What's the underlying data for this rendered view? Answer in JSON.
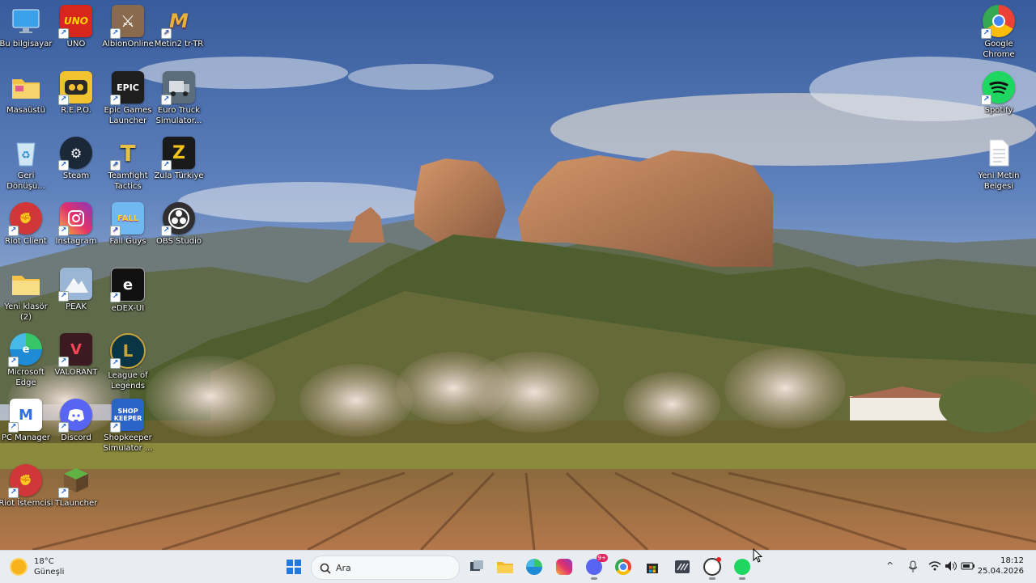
{
  "desktop": {
    "icons": [
      {
        "id": "bu-bilgisayar",
        "label": "Bu bilgisayar",
        "icon": "monitor-icon",
        "color": "#3aa0e8"
      },
      {
        "id": "uno",
        "label": "UNO",
        "icon": "uno-icon",
        "color": "#d8261c"
      },
      {
        "id": "albion",
        "label": "AlbionOnline",
        "icon": "crossed-swords-icon",
        "color": "#8a6a4c"
      },
      {
        "id": "metin2",
        "label": "Metin2 tr-TR",
        "icon": "metin2-logo-icon",
        "color": "#b92418"
      },
      {
        "id": "masaustu",
        "label": "Masaüstü",
        "icon": "folder-icon",
        "color": "#f3c247"
      },
      {
        "id": "repo",
        "label": "R.E.P.O.",
        "icon": "robot-face-icon",
        "color": "#2a2a2a"
      },
      {
        "id": "epic",
        "label": "Epic Games\nLauncher",
        "icon": "epic-games-icon",
        "color": "#1e1e1e"
      },
      {
        "id": "ets",
        "label": "Euro Truck\nSimulator...",
        "icon": "truck-icon",
        "color": "#5b6c7a"
      },
      {
        "id": "geri",
        "label": "Geri\nDönüşü...",
        "icon": "recycle-bin-icon",
        "color": "#b9d8ee"
      },
      {
        "id": "steam",
        "label": "Steam",
        "icon": "steam-icon",
        "color": "#1b2838"
      },
      {
        "id": "tft",
        "label": "Teamfight\nTactics",
        "icon": "tft-icon",
        "color": "#c8a23a"
      },
      {
        "id": "zula",
        "label": "Zula Türkiye",
        "icon": "zula-icon",
        "color": "#1a1a1a"
      },
      {
        "id": "riot",
        "label": "Riot Client",
        "icon": "riot-fist-icon",
        "color": "#d13639"
      },
      {
        "id": "instagram",
        "label": "Instagram",
        "icon": "instagram-icon",
        "color": "#d8327d"
      },
      {
        "id": "fallguys",
        "label": "Fall Guys",
        "icon": "fall-guys-icon",
        "color": "#6fb8f0"
      },
      {
        "id": "obs",
        "label": "OBS Studio",
        "icon": "obs-icon",
        "color": "#302e31"
      },
      {
        "id": "yeniklasor",
        "label": "Yeni klasör\n(2)",
        "icon": "folder-icon",
        "color": "#f3d36a"
      },
      {
        "id": "peak",
        "label": "PEAK",
        "icon": "mountain-icon",
        "color": "#9ab6d4"
      },
      {
        "id": "edex",
        "label": "eDEX-UI",
        "icon": "edex-icon",
        "color": "#111111"
      },
      {
        "id": "edge",
        "label": "Microsoft\nEdge",
        "icon": "edge-icon",
        "color": "#1f8ad6"
      },
      {
        "id": "valorant",
        "label": "VALORANT",
        "icon": "valorant-icon",
        "color": "#3b1a22"
      },
      {
        "id": "lol",
        "label": "League of\nLegends",
        "icon": "league-icon",
        "color": "#0a3545"
      },
      {
        "id": "pcmanager",
        "label": "PC Manager",
        "icon": "pc-manager-icon",
        "color": "#ffffff"
      },
      {
        "id": "discord",
        "label": "Discord",
        "icon": "discord-icon",
        "color": "#5865f2"
      },
      {
        "id": "shopkeeper",
        "label": "Shopkeeper\nSimulator ...",
        "icon": "shopkeeper-icon",
        "color": "#2a64c9"
      },
      {
        "id": "riotist",
        "label": "Riot İstemcisi",
        "icon": "riot-fist-icon",
        "color": "#d13639"
      },
      {
        "id": "tlauncher",
        "label": "TLauncher",
        "icon": "grass-block-icon",
        "color": "#4f9a3a"
      },
      {
        "id": "chrome",
        "label": "Google\nChrome",
        "icon": "chrome-icon",
        "color": "#ffffff"
      },
      {
        "id": "spotify",
        "label": "Spotify",
        "icon": "spotify-icon",
        "color": "#1ed760"
      },
      {
        "id": "yenimetin",
        "label": "Yeni Metin\nBelgesi",
        "icon": "text-document-icon",
        "color": "#ffffff"
      }
    ]
  },
  "taskbar": {
    "weather": {
      "temp": "18°C",
      "condition": "Güneşli",
      "icon": "sun-icon"
    },
    "search_placeholder": "Ara",
    "pinned": [
      "start-icon",
      "search-icon",
      "task-view-icon",
      "file-explorer-icon",
      "edge-icon",
      "instagram-icon",
      "discord-icon",
      "chrome-icon",
      "store-icon",
      "app-icon",
      "obs-icon",
      "spotify-icon"
    ],
    "discord_badge": "9+",
    "tray": [
      "chevron-up-icon",
      "microphone-icon",
      "wifi-icon",
      "speaker-icon",
      "battery-icon"
    ],
    "time": "18:12",
    "date": "25.04.2026"
  }
}
